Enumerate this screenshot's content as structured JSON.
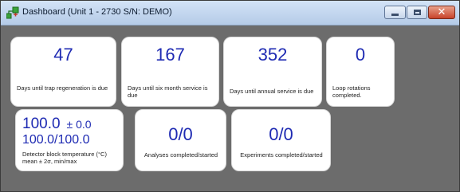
{
  "window": {
    "title": "Dashboard (Unit 1 - 2730 S/N: DEMO)",
    "icons": {
      "app": "network-plus-icon",
      "minimize": "minimize-icon",
      "maximize": "maximize-icon",
      "close": "close-icon"
    }
  },
  "tiles": [
    {
      "value": "47",
      "label": "Days until trap regeneration is due"
    },
    {
      "value": "167",
      "label": "Days until six month service is due"
    },
    {
      "value": "352",
      "label": "Days until annual service is due"
    },
    {
      "value": "0",
      "label": "Loop rotations completed."
    }
  ],
  "temperature": {
    "mean": "100.0",
    "sigma": "± 0.0",
    "minmax": "100.0/100.0",
    "label_line1": "Detector block temperature (°C)",
    "label_line2": "mean ± 2σ, min/max"
  },
  "analyses": {
    "value": "0/0",
    "label": "Analyses completed/started"
  },
  "experiments": {
    "value": "0/0",
    "label": "Experiments completed/started"
  },
  "colors": {
    "value_text": "#1f2bb3",
    "background": "#6c6c6c",
    "tile": "#ffffff"
  }
}
